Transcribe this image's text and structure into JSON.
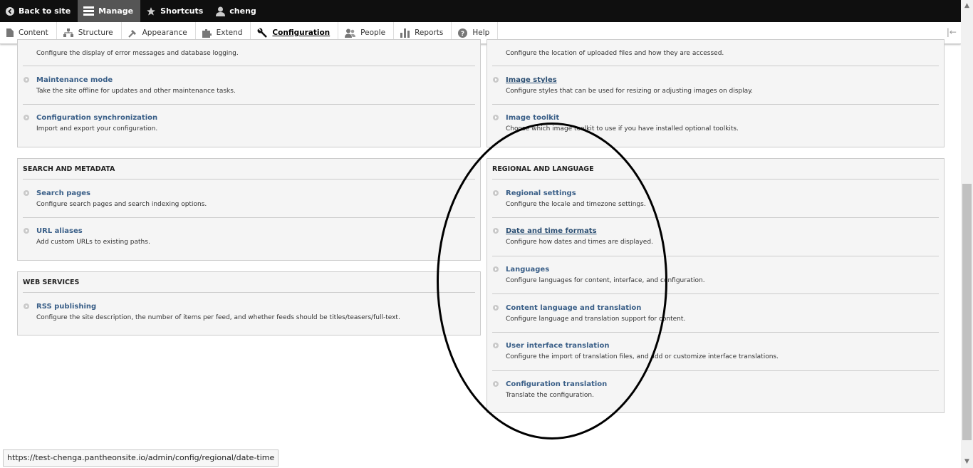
{
  "toolbar": {
    "back_to_site": "Back to site",
    "manage": "Manage",
    "shortcuts": "Shortcuts",
    "user": "cheng"
  },
  "tray": {
    "items": [
      {
        "label": "Content",
        "icon": "content-icon"
      },
      {
        "label": "Structure",
        "icon": "structure-icon"
      },
      {
        "label": "Appearance",
        "icon": "appearance-icon"
      },
      {
        "label": "Extend",
        "icon": "extend-icon"
      },
      {
        "label": "Configuration",
        "icon": "wrench-icon",
        "active": true
      },
      {
        "label": "People",
        "icon": "people-icon"
      },
      {
        "label": "Reports",
        "icon": "reports-icon"
      },
      {
        "label": "Help",
        "icon": "help-icon"
      }
    ]
  },
  "development": {
    "items": [
      {
        "label": "",
        "desc": "Configure the display of error messages and database logging."
      },
      {
        "label": "Maintenance mode",
        "desc": "Take the site offline for updates and other maintenance tasks."
      },
      {
        "label": "Configuration synchronization",
        "desc": "Import and export your configuration."
      }
    ]
  },
  "media": {
    "items": [
      {
        "label": "",
        "desc": "Configure the location of uploaded files and how they are accessed."
      },
      {
        "label": "Image styles",
        "desc": "Configure styles that can be used for resizing or adjusting images on display."
      },
      {
        "label": "Image toolkit",
        "desc": "Choose which image toolkit to use if you have installed optional toolkits."
      }
    ]
  },
  "search": {
    "title": "SEARCH AND METADATA",
    "items": [
      {
        "label": "Search pages",
        "desc": "Configure search pages and search indexing options."
      },
      {
        "label": "URL aliases",
        "desc": "Add custom URLs to existing paths."
      }
    ]
  },
  "web_services": {
    "title": "WEB SERVICES",
    "items": [
      {
        "label": "RSS publishing",
        "desc": "Configure the site description, the number of items per feed, and whether feeds should be titles/teasers/full-text."
      }
    ]
  },
  "regional": {
    "title": "REGIONAL AND LANGUAGE",
    "items": [
      {
        "label": "Regional settings",
        "desc": "Configure the locale and timezone settings."
      },
      {
        "label": "Date and time formats",
        "desc": "Configure how dates and times are displayed."
      },
      {
        "label": "Languages",
        "desc": "Configure languages for content, interface, and configuration."
      },
      {
        "label": "Content language and translation",
        "desc": "Configure language and translation support for content."
      },
      {
        "label": "User interface translation",
        "desc": "Configure the import of translation files, and add or customize interface translations."
      },
      {
        "label": "Configuration translation",
        "desc": "Translate the configuration."
      }
    ]
  },
  "status_url": "https://test-chenga.pantheonsite.io/admin/config/regional/date-time"
}
